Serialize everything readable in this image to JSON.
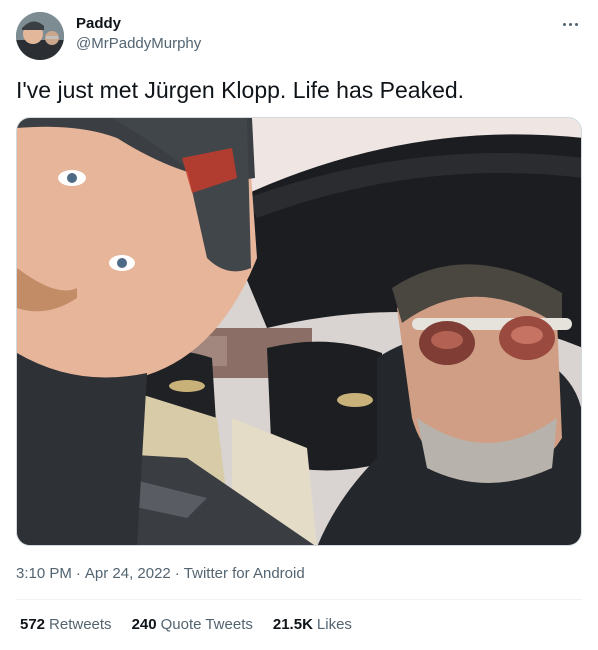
{
  "author": {
    "display_name": "Paddy",
    "handle": "@MrPaddyMurphy",
    "avatar": "profile-photo"
  },
  "more_icon": "more-horizontal-icon",
  "tweet": {
    "text": "I've just met Jürgen Klopp. Life has Peaked.",
    "media": "photo-selfie-in-car"
  },
  "meta": {
    "time": "3:10 PM",
    "separator": "·",
    "date": "Apr 24, 2022",
    "source": "Twitter for Android"
  },
  "stats": {
    "retweets_count": "572",
    "retweets_label": "Retweets",
    "quotes_count": "240",
    "quotes_label": "Quote Tweets",
    "likes_count": "21.5K",
    "likes_label": "Likes"
  },
  "colors": {
    "text_primary": "#0f1419",
    "text_secondary": "#536471",
    "divider": "#eff3f4"
  }
}
